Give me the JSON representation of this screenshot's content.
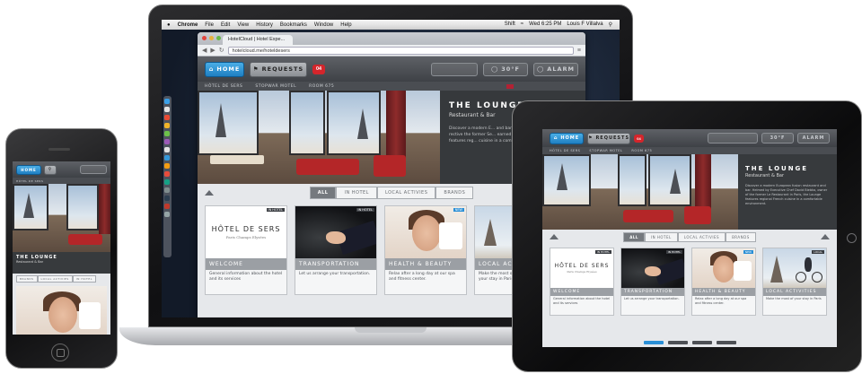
{
  "mac_menubar": {
    "app": "Chrome",
    "menus": [
      "File",
      "Edit",
      "View",
      "History",
      "Bookmarks",
      "Window",
      "Help"
    ],
    "status": [
      "Shift",
      "Wed 6:25 PM",
      "Louis F Villalva"
    ]
  },
  "browser": {
    "tab_title": "HotelCloud | Hotel Expe...",
    "url": "hotelcloud.me/hoteldesers"
  },
  "app": {
    "home_label": "HOME",
    "requests_label": "REQUESTS",
    "requests_count": "04",
    "temperature": "30°F",
    "alarm_label": "ALARM",
    "sub_nav": [
      "HÔTEL DE SERS",
      "STOPWAR MOTEL",
      "ROOM 675"
    ],
    "hero": {
      "title": "THE LOUNGE",
      "subtitle": "Restaurant & Bar",
      "body": "Discover a modern European fusion restaurant and bar. Helmed by Executive Chef David Biebka, owner of the former Le Restaurant in Paris, the Lounge features regional French cuisine in a comfortable environment.",
      "body_short": "Discover a modern E... and bar. Helmed... Chef David Biek... rective the former Se... earned consecutive M... Lounge features reg... cuisine in a comforta..."
    },
    "filters": [
      "ALL",
      "IN HOTEL",
      "LOCAL ACTIVIES",
      "BRANDS"
    ],
    "cards": [
      {
        "tag": "IN HOTEL",
        "caption": "WELCOME",
        "desc": "General information about the hotel and its services",
        "logo_title": "HÔTEL DE SERS",
        "logo_sub": "Paris Champs Elysées"
      },
      {
        "tag": "IN HOTEL",
        "caption": "TRANSPORTATION",
        "desc": "Let us arrange your transportation."
      },
      {
        "tag": "NEW",
        "caption": "HEALTH & BEAUTY",
        "desc": "Relax after a long day at our spa and fitness center."
      },
      {
        "tag": "LOCAL",
        "caption": "LOCAL ACTIVITIES",
        "desc": "Make the most of your stay in Paris"
      }
    ]
  },
  "tablet": {
    "visible_filters": [
      "ALL",
      "IN HOTEL",
      "LOCAL ACTIVIES",
      "BRANDS"
    ],
    "pager_count": 4,
    "pager_active": 0
  },
  "phone": {
    "home_label": "HOME",
    "hero_title": "THE LOUNGE",
    "hero_sub": "Restaurant & Bar"
  },
  "colors": {
    "accent_blue": "#1f7fc2",
    "badge_red": "#d4252b",
    "sofa_red": "#b42628"
  }
}
